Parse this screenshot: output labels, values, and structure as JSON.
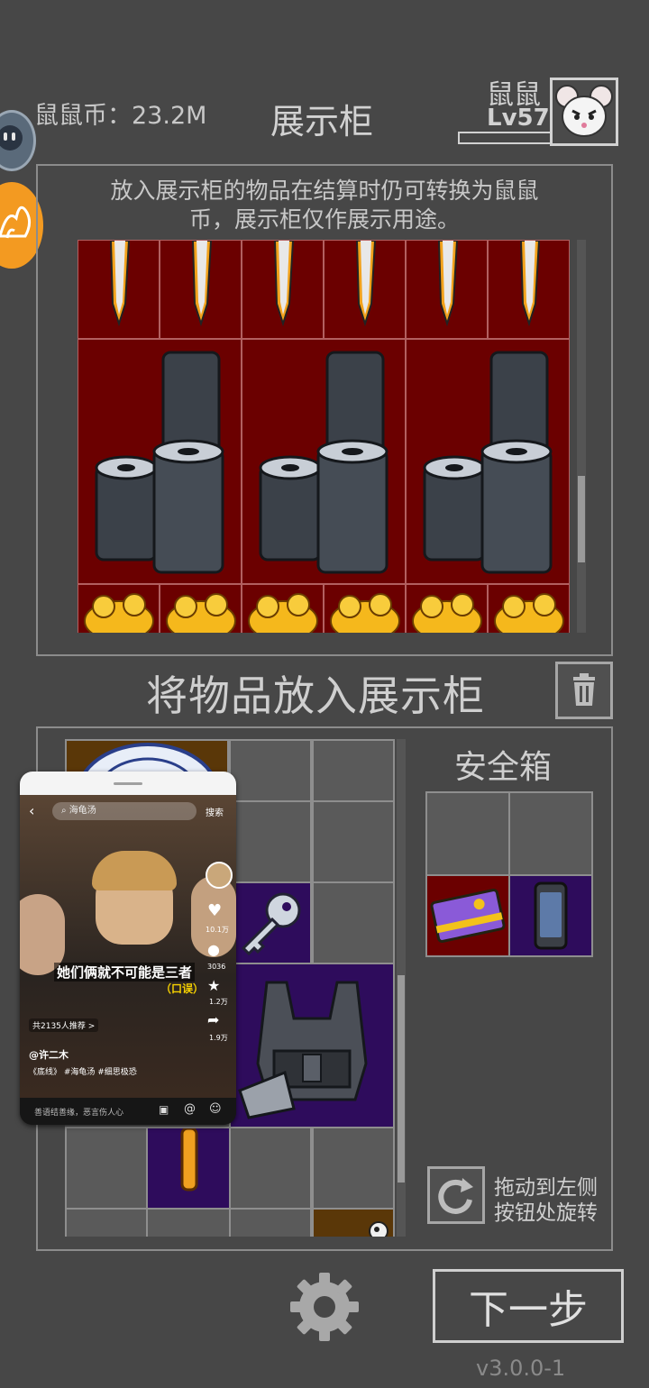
{
  "header": {
    "coin_label": "鼠鼠币：",
    "coin_value": "23.2M",
    "title": "展示柜",
    "player_name": "鼠鼠",
    "player_level": "Lv57"
  },
  "display_cabinet": {
    "notice": "放入展示柜的物品在结算时仍可转换为鼠鼠币，展示柜仅作展示用途。"
  },
  "put_in": {
    "title": "将物品放入展示柜"
  },
  "safe_box": {
    "title": "安全箱"
  },
  "rotate": {
    "hint_line1": "拖动到左侧",
    "hint_line2": "按钮处旋转"
  },
  "footer": {
    "next_label": "下一步",
    "version": "v3.0.0-1"
  },
  "overlay_video": {
    "search_placeholder": "海龟汤",
    "search_button": "搜索",
    "caption_main": "她们俩就不可能是三者",
    "caption_sub": "（口误）",
    "likes": "10.1万",
    "comments": "3036",
    "favorites": "1.2万",
    "shares": "1.9万",
    "recommend": "共2135人推荐 >",
    "author": "@许二木",
    "tags": "《底线》 #海龟汤 #细思极恐",
    "comment_placeholder": "善语结善缘，恶言伤人心"
  },
  "colors": {
    "background": "#474747",
    "display_bg": "#6b0000",
    "purple_bg": "#2e0c5c",
    "accent_orange": "#f39a21"
  }
}
